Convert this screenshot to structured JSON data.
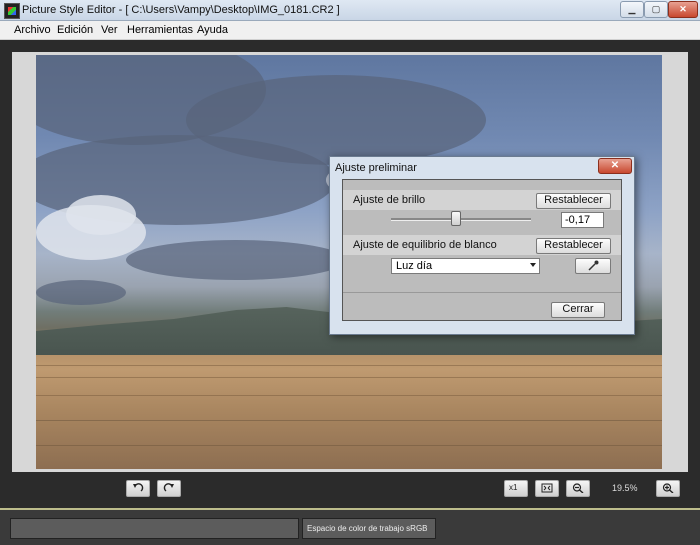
{
  "window": {
    "title": "Picture Style Editor - [ C:\\Users\\Vampy\\Desktop\\IMG_0181.CR2 ]",
    "min_glyph": "▁",
    "max_glyph": "▢",
    "close_glyph": "✕"
  },
  "menu": {
    "items": [
      "Archivo",
      "Edición",
      "Ver",
      "Herramientas",
      "Ayuda"
    ]
  },
  "dialog": {
    "title": "Ajuste preliminar",
    "close_glyph": "✕",
    "brightness_label": "Ajuste de brillo",
    "brightness_reset": "Restablecer",
    "brightness_value": "-0,17",
    "brightness_slider_fraction": 0.46,
    "wb_label": "Ajuste de equilibrio de blanco",
    "wb_reset": "Restablecer",
    "wb_selected": "Luz día",
    "close_button": "Cerrar"
  },
  "toolbar": {
    "zoom_text": "19.5%",
    "x1_text": "x1"
  },
  "status": {
    "left_text": "",
    "right_text": "Espacio de color de trabajo sRGB"
  }
}
